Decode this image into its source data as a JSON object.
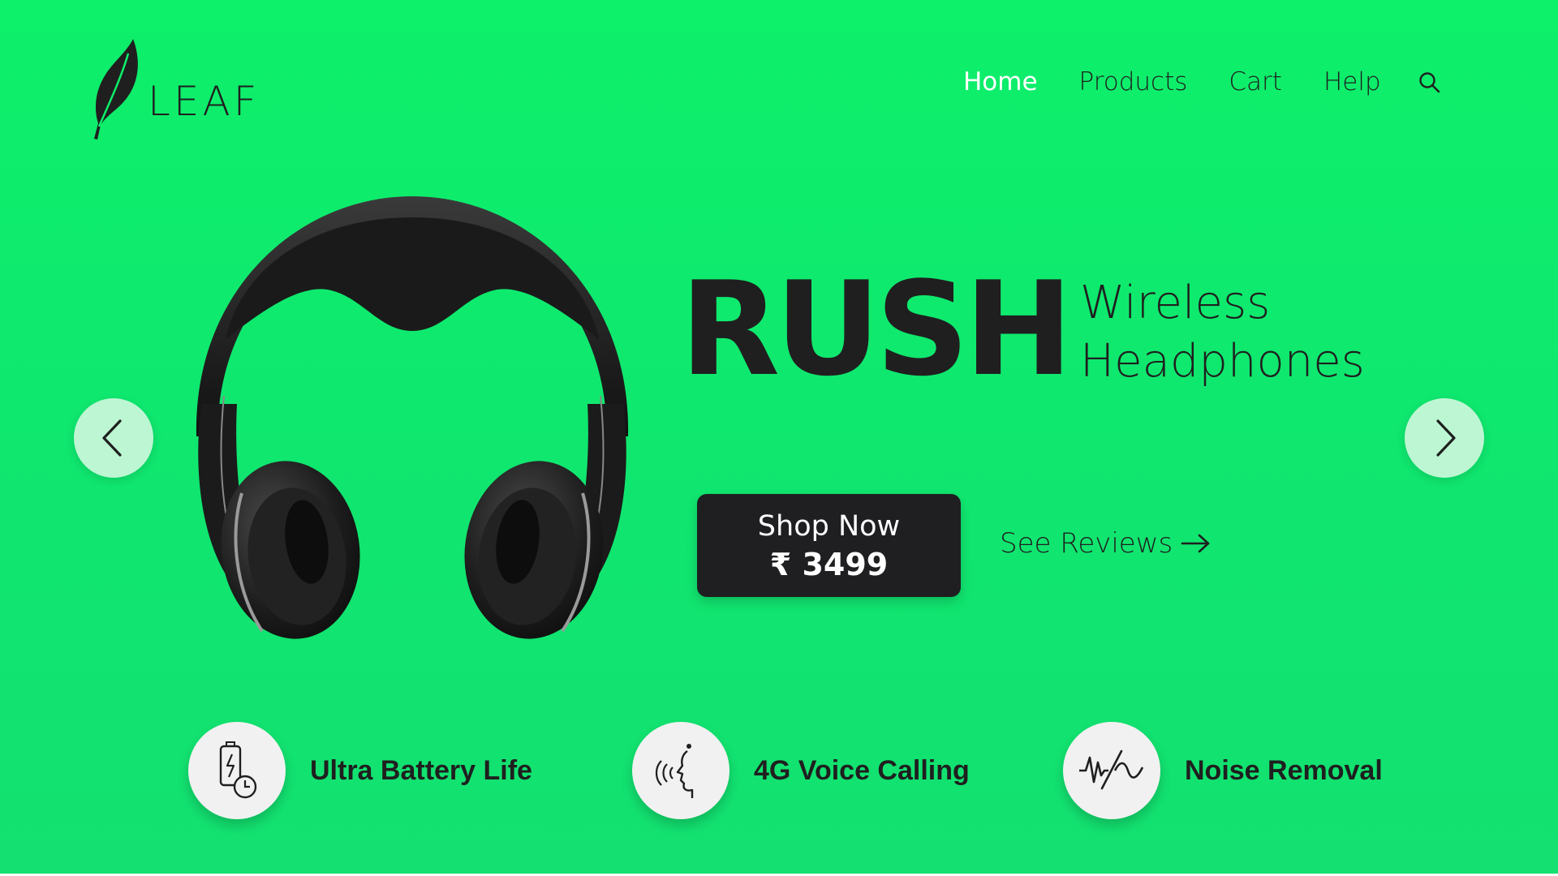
{
  "brand": {
    "name": "LEAF",
    "logo_icon": "leaf-icon"
  },
  "nav": {
    "items": [
      {
        "label": "Home",
        "active": true
      },
      {
        "label": "Products",
        "active": false
      },
      {
        "label": "Cart",
        "active": false
      },
      {
        "label": "Help",
        "active": false
      }
    ],
    "search_icon": "search-icon"
  },
  "carousel": {
    "prev_icon": "chevron-left-icon",
    "next_icon": "chevron-right-icon"
  },
  "hero": {
    "product_name": "RUSH",
    "subtitle_line1": "Wireless",
    "subtitle_line2": "Headphones",
    "product_image": "headphones-image"
  },
  "cta": {
    "shop_label": "Shop Now",
    "price": "₹ 3499",
    "reviews_label": "See Reviews",
    "reviews_icon": "arrow-right-icon"
  },
  "features": [
    {
      "label": "Ultra Battery Life",
      "icon": "battery-clock-icon"
    },
    {
      "label": "4G Voice Calling",
      "icon": "voice-speaking-icon"
    },
    {
      "label": "Noise Removal",
      "icon": "noise-wave-icon"
    }
  ],
  "colors": {
    "background": "#0df06a",
    "dark": "#1f1f22",
    "active_nav": "#ffffff",
    "arrow_button": "#bdf6d3",
    "feature_circle": "#f1f1f1"
  }
}
